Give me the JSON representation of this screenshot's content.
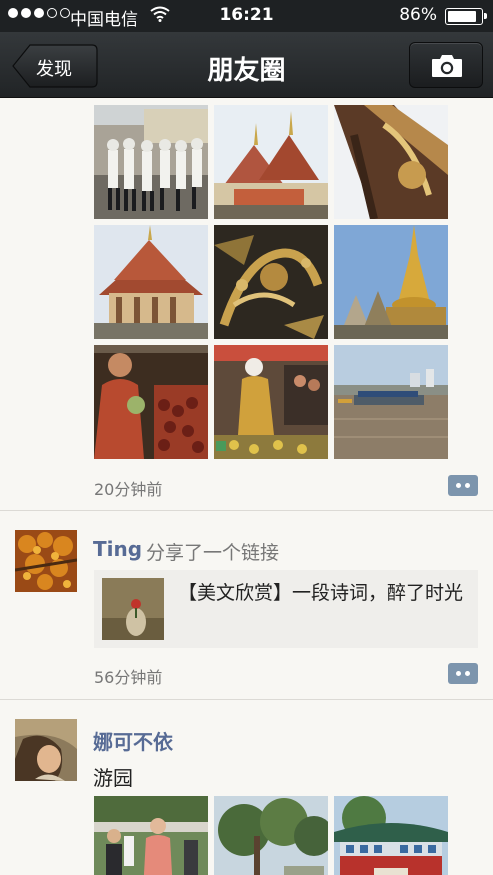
{
  "status_bar": {
    "carrier": "中国电信",
    "time": "16:21",
    "battery_percent": "86%",
    "battery_level": 0.86,
    "signal_bars": 3,
    "signal_total": 5
  },
  "nav": {
    "back_label": "发现",
    "title": "朋友圈",
    "camera_icon": "camera-icon"
  },
  "posts": [
    {
      "timestamp": "20分钟前",
      "photos": [
        "royal-guards-photo",
        "temple-roofs-photo",
        "temple-eave-photo",
        "temple-hall-photo",
        "gold-mural-photo",
        "golden-stupa-photo",
        "fruit-vendor-photo",
        "market-stall-photo",
        "river-boats-photo"
      ]
    },
    {
      "author": "Ting",
      "action": "分享了一个链接",
      "link_title": "【美文欣赏】一段诗词，醉了时光",
      "timestamp": "56分钟前"
    },
    {
      "author": "娜可不依",
      "text": "游园",
      "photos": [
        "garden-people-photo",
        "garden-trees-photo",
        "chinese-gate-photo"
      ]
    }
  ],
  "colors": {
    "name_blue": "#576b95",
    "nav_dark": "#212426",
    "background": "#f8f7f3"
  }
}
